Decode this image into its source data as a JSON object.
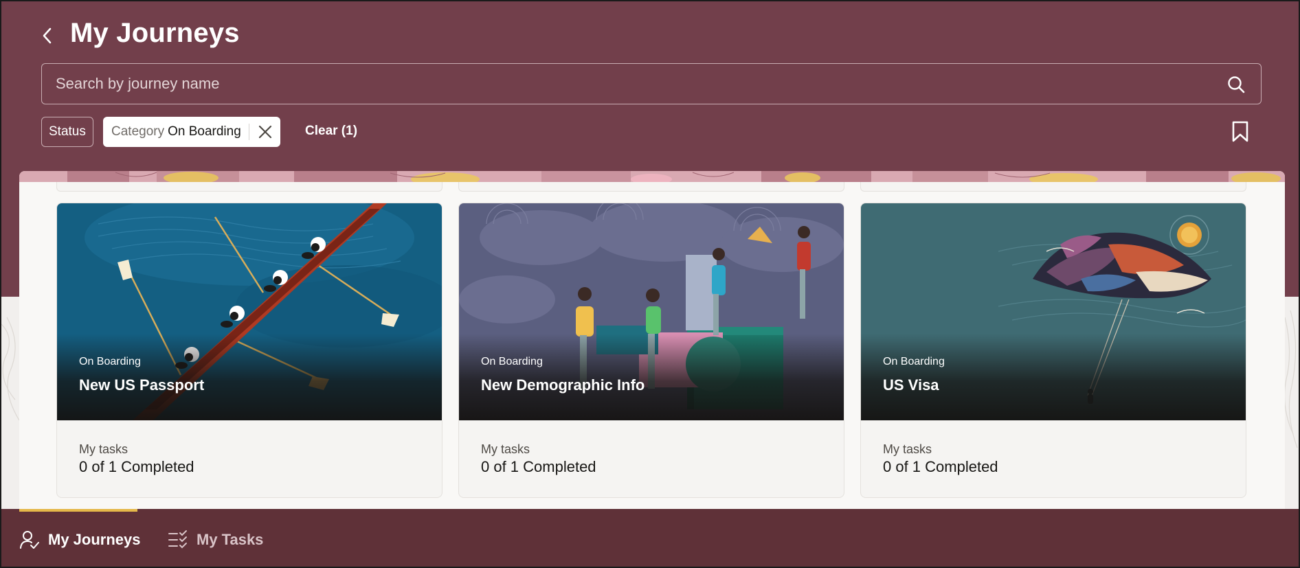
{
  "header": {
    "title": "My Journeys",
    "back_icon": "chevron-left-icon"
  },
  "search": {
    "placeholder": "Search by journey name",
    "value": "",
    "icon": "search-icon"
  },
  "filters": {
    "status_label": "Status",
    "category_label": "Category",
    "category_value": "On Boarding",
    "clear_label": "Clear (1)",
    "bookmark_icon": "bookmark-icon"
  },
  "cards": [
    {
      "category": "On Boarding",
      "title": "New US Passport",
      "tasks_label": "My tasks",
      "tasks_value": "0 of 1 Completed"
    },
    {
      "category": "On Boarding",
      "title": "New Demographic Info",
      "tasks_label": "My tasks",
      "tasks_value": "0 of 1 Completed"
    },
    {
      "category": "On Boarding",
      "title": "US Visa",
      "tasks_label": "My tasks",
      "tasks_value": "0 of 1 Completed"
    }
  ],
  "bottom_nav": {
    "items": [
      {
        "label": "My Journeys",
        "icon": "user-check-icon",
        "active": true
      },
      {
        "label": "My Tasks",
        "icon": "checklist-icon",
        "active": false
      }
    ]
  },
  "colors": {
    "header_bg": "#723f4b",
    "nav_bg": "#5f3138",
    "active_indicator": "#e5b84a",
    "panel_bg": "#f9f8f6"
  }
}
